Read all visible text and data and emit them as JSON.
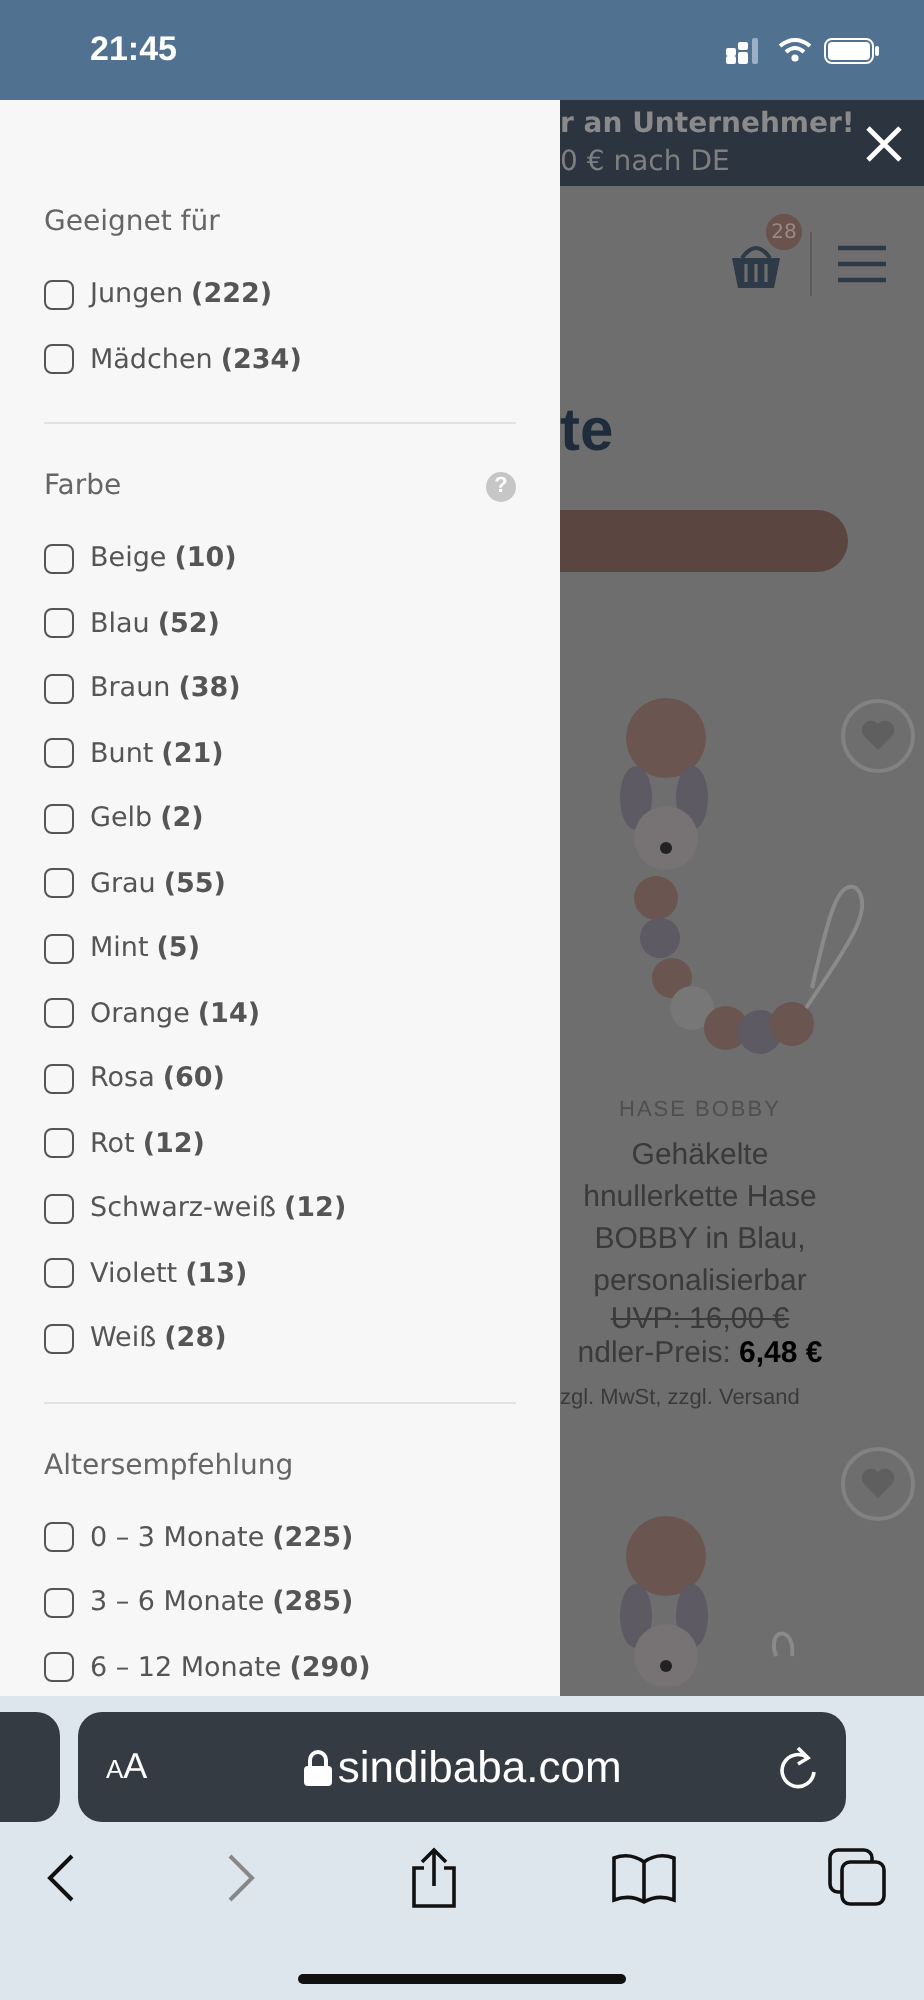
{
  "status_bar": {
    "time": "21:45"
  },
  "filter_drawer": {
    "sections": [
      {
        "title": "Geeignet für",
        "options": [
          {
            "label": "Jungen",
            "count": "(222)",
            "checked": false
          },
          {
            "label": "Mädchen",
            "count": "(234)",
            "checked": false
          }
        ]
      },
      {
        "title": "Farbe",
        "help_icon": "?",
        "options": [
          {
            "label": "Beige",
            "count": "(10)",
            "checked": false
          },
          {
            "label": "Blau",
            "count": "(52)",
            "checked": false
          },
          {
            "label": "Braun",
            "count": "(38)",
            "checked": false
          },
          {
            "label": "Bunt",
            "count": "(21)",
            "checked": false
          },
          {
            "label": "Gelb",
            "count": "(2)",
            "checked": false
          },
          {
            "label": "Grau",
            "count": "(55)",
            "checked": false
          },
          {
            "label": "Mint",
            "count": "(5)",
            "checked": false
          },
          {
            "label": "Orange",
            "count": "(14)",
            "checked": false
          },
          {
            "label": "Rosa",
            "count": "(60)",
            "checked": false
          },
          {
            "label": "Rot",
            "count": "(12)",
            "checked": false
          },
          {
            "label": "Schwarz-weiß",
            "count": "(12)",
            "checked": false
          },
          {
            "label": "Violett",
            "count": "(13)",
            "checked": false
          },
          {
            "label": "Weiß",
            "count": "(28)",
            "checked": false
          }
        ]
      },
      {
        "title": "Altersempfehlung",
        "options": [
          {
            "label": "0 – 3 Monate",
            "count": "(225)",
            "checked": false
          },
          {
            "label": "3 – 6 Monate",
            "count": "(285)",
            "checked": false
          },
          {
            "label": "6 – 12 Monate",
            "count": "(290)",
            "checked": false
          }
        ]
      }
    ]
  },
  "background_page": {
    "banner": {
      "line_1": "r an Unternehmer!",
      "line_2": "0 € nach DE"
    },
    "cart_count": "28",
    "heading": "te",
    "products": [
      {
        "brand": "HASE BOBBY",
        "title_lines": [
          "Gehäkelte",
          "hnullerkette Hase",
          "BOBBY in Blau,",
          "personalisierbar"
        ],
        "old_price": "UVP: 16,00 €",
        "price_label": "ndler-Preis:",
        "price": "6,48 €",
        "tax_note": "zgl. MwSt, zzgl. Versand"
      },
      {
        "kind": "picture"
      }
    ]
  },
  "browser": {
    "text_size_button": "AA",
    "url": "sindibaba.com"
  }
}
